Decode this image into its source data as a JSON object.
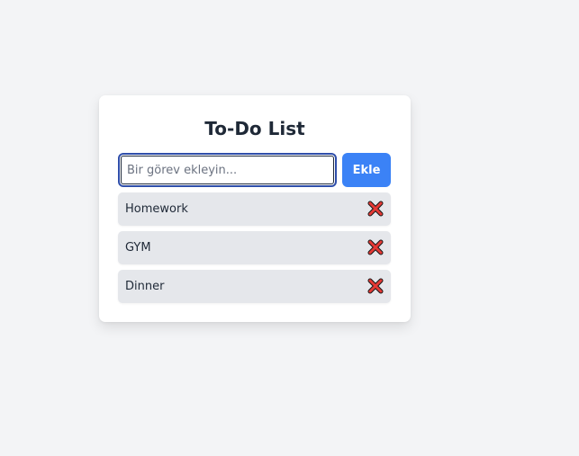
{
  "app": {
    "title": "To-Do List"
  },
  "input": {
    "placeholder": "Bir görev ekleyin...",
    "value": ""
  },
  "buttons": {
    "add_label": "Ekle"
  },
  "tasks": [
    {
      "label": "Homework",
      "delete_icon": "cross-mark-icon"
    },
    {
      "label": "GYM",
      "delete_icon": "cross-mark-icon"
    },
    {
      "label": "Dinner",
      "delete_icon": "cross-mark-icon"
    }
  ],
  "colors": {
    "background": "#f3f4f6",
    "card": "#ffffff",
    "accent": "#3b82f6",
    "task_bg": "#e5e7eb",
    "delete_red": "#e53935",
    "title_text": "#1f2937"
  }
}
